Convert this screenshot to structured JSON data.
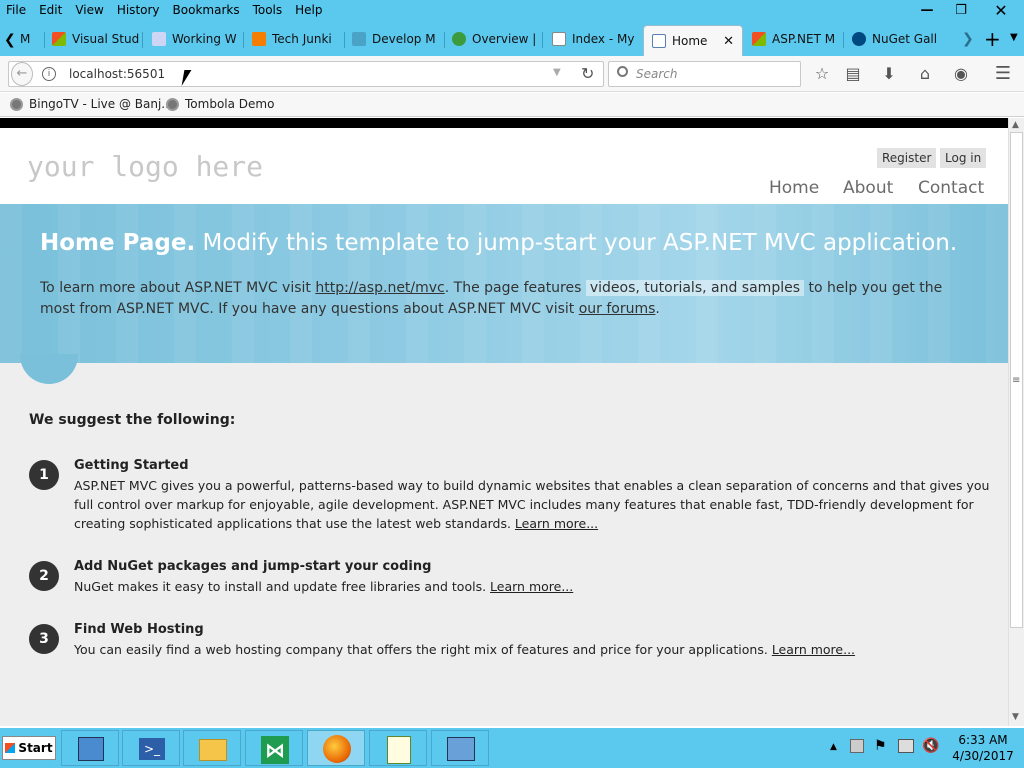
{
  "menubar": {
    "items": [
      {
        "label": "File"
      },
      {
        "label": "Edit"
      },
      {
        "label": "View"
      },
      {
        "label": "History"
      },
      {
        "label": "Bookmarks"
      },
      {
        "label": "Tools"
      },
      {
        "label": "Help"
      }
    ]
  },
  "tabs": [
    {
      "label": "M",
      "color": "#666"
    },
    {
      "label": "Visual Stud",
      "color": "#e74c2f"
    },
    {
      "label": "Working W",
      "color": "#d9d9ff"
    },
    {
      "label": "Tech Junki",
      "color": "#f57d00"
    },
    {
      "label": "Develop M",
      "color": "#4aa3c7"
    },
    {
      "label": "Overview |",
      "color": "#3c9b3c"
    },
    {
      "label": "Index - My",
      "color": "#ffffff"
    },
    {
      "label": "Home",
      "color": "#5a7fb5"
    },
    {
      "label": "ASP.NET M",
      "color": "#e74c2f"
    },
    {
      "label": "NuGet Gall",
      "color": "#004880"
    }
  ],
  "navbar": {
    "url": "localhost:56501",
    "search_placeholder": "Search"
  },
  "bookmarks": [
    {
      "label": "BingoTV - Live @ Banj..."
    },
    {
      "label": "Tombola Demo"
    }
  ],
  "page": {
    "logo": "your logo here",
    "register": "Register",
    "login": "Log in",
    "nav": [
      "Home",
      "About",
      "Contact"
    ],
    "featured_title_bold": "Home Page.",
    "featured_title_rest": " Modify this template to jump-start your ASP.NET MVC application.",
    "featured_text_1": "To learn more about ASP.NET MVC visit ",
    "featured_link_1": "http://asp.net/mvc",
    "featured_text_2": ". The page features ",
    "featured_highlight": "videos, tutorials, and samples",
    "featured_text_3": " to help you get the most from ASP.NET MVC. If you have any questions about ASP.NET MVC visit ",
    "featured_link_2": "our forums",
    "featured_text_4": ".",
    "suggest_title": "We suggest the following:",
    "steps": [
      {
        "num": "1",
        "title": "Getting Started",
        "text": "ASP.NET MVC gives you a powerful, patterns-based way to build dynamic websites that enables a clean separation of concerns and that gives you full control over markup for enjoyable, agile development. ASP.NET MVC includes many features that enable fast, TDD-friendly development for creating sophisticated applications that use the latest web standards. ",
        "link": "Learn more..."
      },
      {
        "num": "2",
        "title": "Add NuGet packages and jump-start your coding",
        "text": "NuGet makes it easy to install and update free libraries and tools. ",
        "link": "Learn more..."
      },
      {
        "num": "3",
        "title": "Find Web Hosting",
        "text": "You can easily find a web hosting company that offers the right mix of features and price for your applications. ",
        "link": "Learn more..."
      }
    ]
  },
  "taskbar": {
    "start": "Start",
    "time": "6:33 AM",
    "date": "4/30/2017"
  }
}
